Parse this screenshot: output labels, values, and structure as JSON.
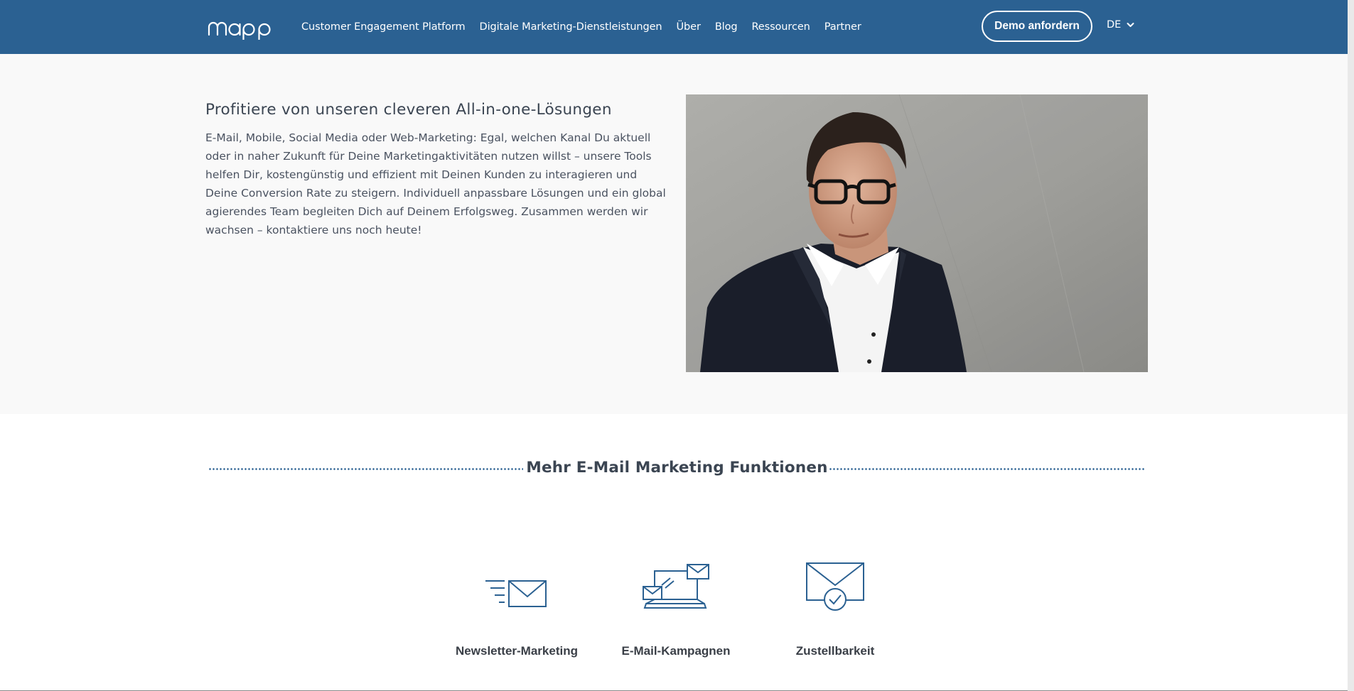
{
  "header": {
    "logo_text": "mapp",
    "nav": [
      "Customer Engagement Platform",
      "Digitale Marketing-Dienstleistungen",
      "Über",
      "Blog",
      "Ressourcen",
      "Partner"
    ],
    "demo_button": "Demo anfordern",
    "language": "DE",
    "background_color": "#2b6192"
  },
  "hero": {
    "title": "Profitiere von unseren cleveren All-in-one-Lösungen",
    "body": "E-Mail, Mobile, Social Media oder Web-Marketing: Egal, welchen Kanal Du aktuell oder in naher Zukunft für Deine Marketingaktivitäten nutzen willst – unsere Tools helfen Dir, kostengünstig und effizient mit Deinen Kunden zu interagieren und Deine Conversion Rate zu steigern. Individuell anpassbare Lösungen und ein global agierendes Team begleiten Dich auf Deinem Erfolgsweg. Zusammen werden wir wachsen – kontaktiere uns noch heute!"
  },
  "features": {
    "title": "Mehr E-Mail Marketing Funktionen",
    "items": [
      {
        "label": "Newsletter-Marketing",
        "icon": "envelope-fast-icon"
      },
      {
        "label": "E-Mail-Kampagnen",
        "icon": "laptop-emails-icon"
      },
      {
        "label": "Zustellbarkeit",
        "icon": "envelope-check-icon"
      }
    ]
  },
  "colors": {
    "brand_blue": "#2b6192",
    "text": "#3b4552"
  }
}
